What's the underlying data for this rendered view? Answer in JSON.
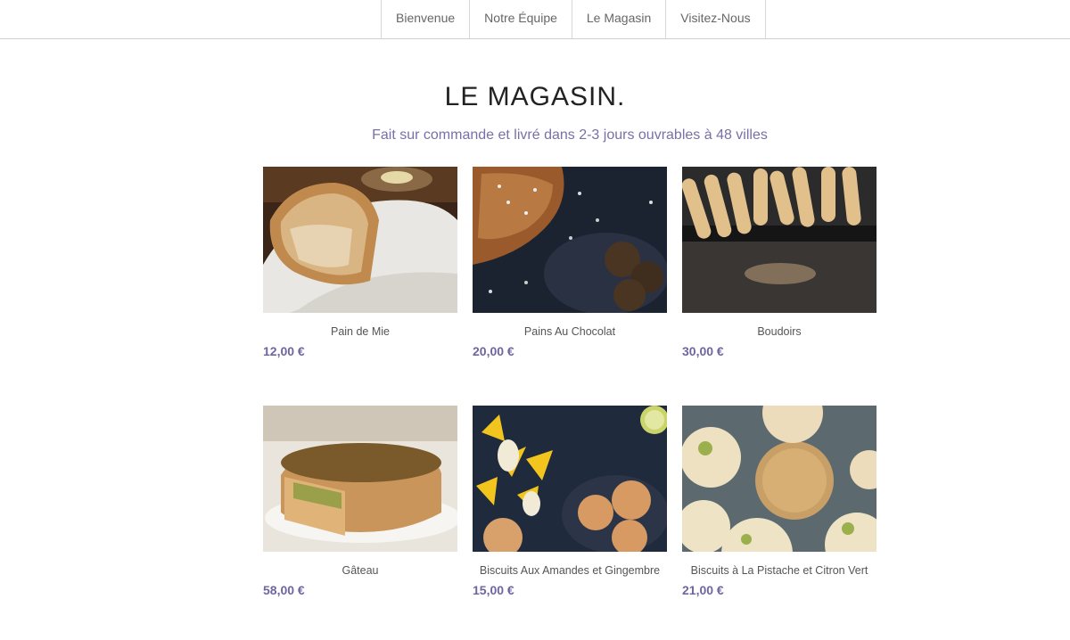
{
  "nav": {
    "items": [
      {
        "label": "Bienvenue"
      },
      {
        "label": "Notre Équipe"
      },
      {
        "label": "Le Magasin"
      },
      {
        "label": "Visitez-Nous"
      }
    ]
  },
  "main": {
    "title": "LE MAGASIN.",
    "subtitle": "Fait sur commande et livré dans 2-3 jours ouvrables à 48 villes"
  },
  "products": [
    {
      "name": "Pain de Mie",
      "price": "12,00 €",
      "image": "bread-loaf-photo"
    },
    {
      "name": "Pains Au Chocolat",
      "price": "20,00 €",
      "image": "chocolate-pastry-photo"
    },
    {
      "name": "Boudoirs",
      "price": "30,00 €",
      "image": "ladyfingers-photo"
    },
    {
      "name": "Gâteau",
      "price": "58,00 €",
      "image": "quiche-cake-photo"
    },
    {
      "name": "Biscuits Aux Amandes et Gingembre",
      "price": "15,00 €",
      "image": "almond-cookies-photo"
    },
    {
      "name": "Biscuits à La Pistache et Citron Vert",
      "price": "21,00 €",
      "image": "pistachio-cookies-photo"
    }
  ],
  "colors": {
    "price": "#6f65a0",
    "subtitle": "#7a6fa6",
    "title": "#222222"
  }
}
